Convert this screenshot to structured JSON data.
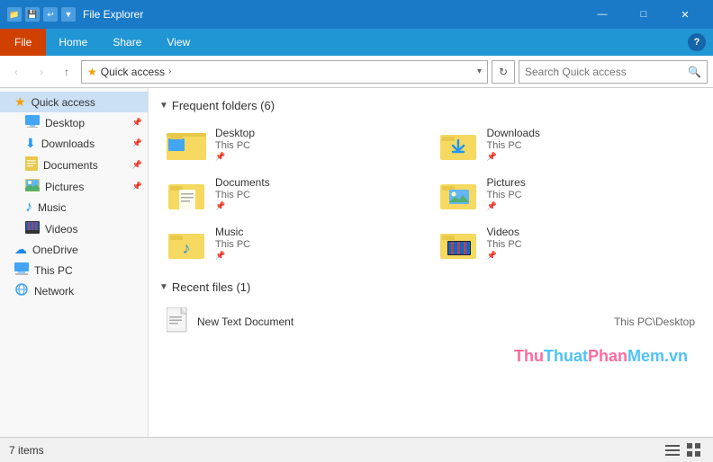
{
  "titleBar": {
    "title": "File Explorer",
    "minimize": "—",
    "maximize": "□",
    "close": "✕"
  },
  "menuBar": {
    "file": "File",
    "home": "Home",
    "share": "Share",
    "view": "View",
    "help": "?"
  },
  "navBar": {
    "back": "‹",
    "forward": "›",
    "up": "↑",
    "addressItems": [
      "Quick access",
      ">"
    ],
    "addressStar": "★",
    "addressText": "Quick access",
    "refreshTitle": "Refresh",
    "searchPlaceholder": "Search Quick access"
  },
  "sidebar": {
    "quickAccessLabel": "Quick access",
    "items": [
      {
        "id": "quick-access",
        "label": "Quick access",
        "icon": "★",
        "active": true
      },
      {
        "id": "desktop",
        "label": "Desktop",
        "icon": "🖥",
        "pinned": true
      },
      {
        "id": "downloads",
        "label": "Downloads",
        "icon": "⬇",
        "pinned": true
      },
      {
        "id": "documents",
        "label": "Documents",
        "icon": "📄",
        "pinned": true
      },
      {
        "id": "pictures",
        "label": "Pictures",
        "icon": "🖼",
        "pinned": true
      },
      {
        "id": "music",
        "label": "Music",
        "icon": "♪",
        "pinned": false
      },
      {
        "id": "videos",
        "label": "Videos",
        "icon": "🎬",
        "pinned": false
      },
      {
        "id": "onedrive",
        "label": "OneDrive",
        "icon": "☁",
        "pinned": false
      },
      {
        "id": "this-pc",
        "label": "This PC",
        "icon": "💻",
        "pinned": false
      },
      {
        "id": "network",
        "label": "Network",
        "icon": "🌐",
        "pinned": false
      }
    ]
  },
  "content": {
    "frequentFoldersHeader": "Frequent folders (6)",
    "recentFilesHeader": "Recent files (1)",
    "folders": [
      {
        "name": "Desktop",
        "location": "This PC",
        "type": "desktop"
      },
      {
        "name": "Downloads",
        "location": "This PC",
        "type": "downloads"
      },
      {
        "name": "Documents",
        "location": "This PC",
        "type": "documents"
      },
      {
        "name": "Pictures",
        "location": "This PC",
        "type": "pictures"
      },
      {
        "name": "Music",
        "location": "This PC",
        "type": "music"
      },
      {
        "name": "Videos",
        "location": "This PC",
        "type": "videos"
      }
    ],
    "recentFiles": [
      {
        "name": "New Text Document",
        "path": "This PC\\Desktop"
      }
    ]
  },
  "statusBar": {
    "itemCount": "7 items"
  },
  "watermark": {
    "thu": "Thu",
    "thuat": "Thuat",
    "phan": "Phan",
    "mem": "Mem",
    "suffix": ".vn"
  }
}
